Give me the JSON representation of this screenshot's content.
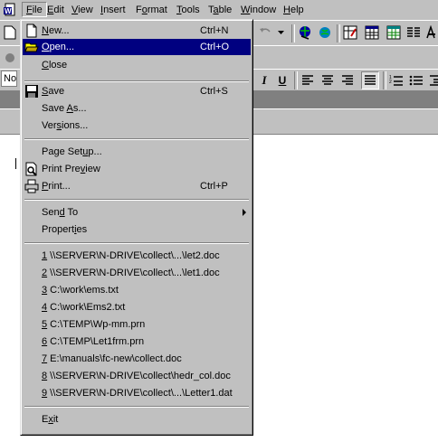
{
  "menubar": {
    "items": [
      {
        "label": "File",
        "key": "F",
        "rest": "ile"
      },
      {
        "label": "Edit",
        "key": "E",
        "rest": "dit"
      },
      {
        "label": "View",
        "key": "V",
        "rest": "iew"
      },
      {
        "label": "Insert",
        "key": "I",
        "rest": "nsert"
      },
      {
        "label": "Format",
        "key": "o",
        "pre": "F",
        "rest": "rmat"
      },
      {
        "label": "Tools",
        "key": "T",
        "rest": "ools"
      },
      {
        "label": "Table",
        "key": "a",
        "pre": "T",
        "rest": "ble"
      },
      {
        "label": "Window",
        "key": "W",
        "rest": "indow"
      },
      {
        "label": "Help",
        "key": "H",
        "rest": "elp"
      }
    ]
  },
  "toolbar": {
    "style_value": "No"
  },
  "file_menu": {
    "new": {
      "pre": "",
      "key": "N",
      "rest": "ew...",
      "shortcut": "Ctrl+N"
    },
    "open": {
      "pre": "",
      "key": "O",
      "rest": "pen...",
      "shortcut": "Ctrl+O"
    },
    "close": {
      "pre": "",
      "key": "C",
      "rest": "lose"
    },
    "save": {
      "pre": "",
      "key": "S",
      "rest": "ave",
      "shortcut": "Ctrl+S"
    },
    "save_as": {
      "pre": "Save ",
      "key": "A",
      "rest": "s..."
    },
    "versions": {
      "pre": "Ver",
      "key": "s",
      "rest": "ions..."
    },
    "page_setup": {
      "pre": "Page Set",
      "key": "u",
      "rest": "p..."
    },
    "print_preview": {
      "pre": "Print Pre",
      "key": "v",
      "rest": "iew"
    },
    "print": {
      "pre": "",
      "key": "P",
      "rest": "rint...",
      "shortcut": "Ctrl+P"
    },
    "send_to": {
      "pre": "Sen",
      "key": "d",
      "rest": " To"
    },
    "properties": {
      "pre": "Propert",
      "key": "i",
      "rest": "es"
    },
    "recent": [
      {
        "num": "1",
        "path": " \\\\SERVER\\N-DRIVE\\collect\\...\\let2.doc"
      },
      {
        "num": "2",
        "path": " \\\\SERVER\\N-DRIVE\\collect\\...\\let1.doc"
      },
      {
        "num": "3",
        "path": " C:\\work\\ems.txt"
      },
      {
        "num": "4",
        "path": " C:\\work\\Ems2.txt"
      },
      {
        "num": "5",
        "path": " C:\\TEMP\\Wp-mm.prn"
      },
      {
        "num": "6",
        "path": " C:\\TEMP\\Let1frm.prn"
      },
      {
        "num": "7",
        "path": " E:\\manuals\\fc-new\\collect.doc"
      },
      {
        "num": "8",
        "path": " \\\\SERVER\\N-DRIVE\\collect\\hedr_col.doc"
      },
      {
        "num": "9",
        "path": " \\\\SERVER\\N-DRIVE\\collect\\...\\Letter1.dat"
      }
    ],
    "exit": {
      "pre": "E",
      "key": "x",
      "rest": "it"
    }
  },
  "colors": {
    "face": "#c0c0c0",
    "highlight": "#000080",
    "shadow": "#808080"
  }
}
